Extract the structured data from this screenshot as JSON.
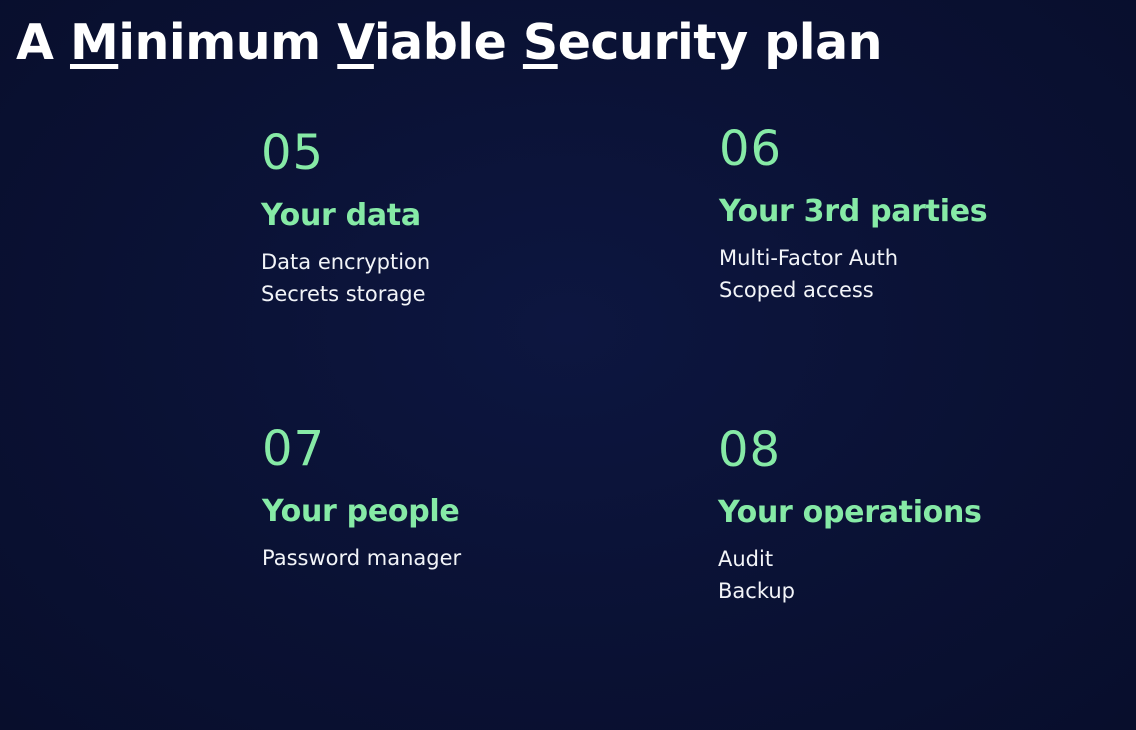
{
  "title": {
    "parts": [
      {
        "text": "A ",
        "underline": false
      },
      {
        "text": "M",
        "underline": true
      },
      {
        "text": "inimum ",
        "underline": false
      },
      {
        "text": "V",
        "underline": true
      },
      {
        "text": "iable ",
        "underline": false
      },
      {
        "text": "S",
        "underline": true
      },
      {
        "text": "ecurity plan",
        "underline": false
      }
    ]
  },
  "cards": [
    {
      "number": "05",
      "heading": "Your data",
      "items": [
        "Data encryption",
        "Secrets storage"
      ]
    },
    {
      "number": "06",
      "heading": "Your 3rd parties",
      "items": [
        "Multi-Factor Auth",
        "Scoped access"
      ]
    },
    {
      "number": "07",
      "heading": "Your people",
      "items": [
        "Password manager"
      ]
    },
    {
      "number": "08",
      "heading": "Your operations",
      "items": [
        "Audit",
        "Backup"
      ]
    }
  ],
  "colors": {
    "background": "#0b1236",
    "accent": "#86eaa6",
    "text": "#f2f4f8"
  }
}
